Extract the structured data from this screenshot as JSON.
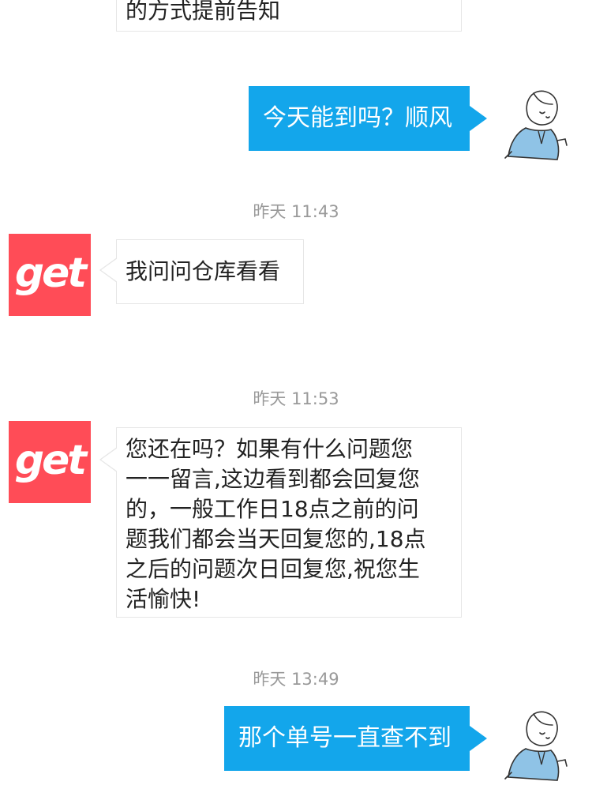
{
  "messages": {
    "partial_top": "的方式提前告知",
    "m1": "今天能到吗？顺风",
    "ts1": "昨天 11:43",
    "m2": "我问问仓库看看",
    "ts2": "昨天 11:53",
    "m3": [
      "您还在吗？如果有什么问题您",
      "一一留言,这边看到都会回复您",
      "的，一般工作日18点之前的问",
      "题我们都会当天回复您的,18点",
      "之后的问题次日回复您,祝您生",
      "活愉快!"
    ],
    "ts3": "昨天 13:49",
    "m4": "那个单号一直查不到"
  },
  "avatars": {
    "shop_logo_text": "get",
    "shop_color": "#ff4c57",
    "user_icon": "user-sketch-avatar-icon"
  },
  "colors": {
    "outgoing_bubble": "#13a6eb",
    "timestamp": "#999999",
    "incoming_border": "#e6e6e6"
  }
}
